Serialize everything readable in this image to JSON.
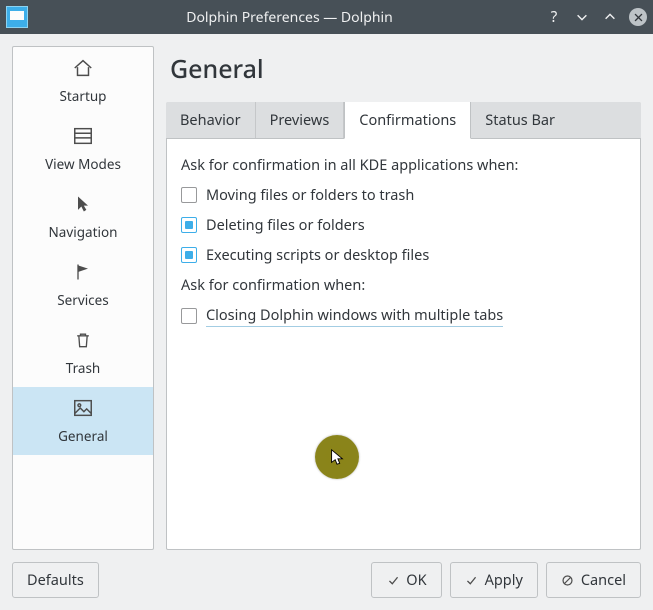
{
  "window": {
    "title": "Dolphin Preferences — Dolphin"
  },
  "sidebar": {
    "items": [
      {
        "label": "Startup"
      },
      {
        "label": "View Modes"
      },
      {
        "label": "Navigation"
      },
      {
        "label": "Services"
      },
      {
        "label": "Trash"
      },
      {
        "label": "General"
      }
    ],
    "selected_index": 5
  },
  "main": {
    "heading": "General",
    "tabs": [
      {
        "label": "Behavior"
      },
      {
        "label": "Previews"
      },
      {
        "label": "Confirmations"
      },
      {
        "label": "Status Bar"
      }
    ],
    "active_tab_index": 2,
    "confirmations": {
      "prompt_global": "Ask for confirmation in all KDE applications when:",
      "options_global": [
        {
          "label": "Moving files or folders to trash",
          "checked": false
        },
        {
          "label": "Deleting files or folders",
          "checked": true
        },
        {
          "label": "Executing scripts or desktop files",
          "checked": true
        }
      ],
      "prompt_local": "Ask for confirmation when:",
      "options_local": [
        {
          "label": "Closing Dolphin windows with multiple tabs",
          "checked": false
        }
      ]
    }
  },
  "footer": {
    "defaults": "Defaults",
    "ok": "OK",
    "apply": "Apply",
    "cancel": "Cancel"
  }
}
